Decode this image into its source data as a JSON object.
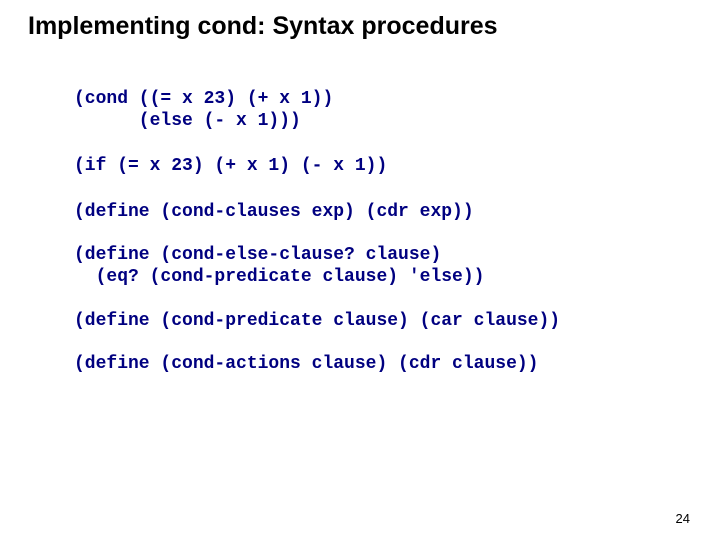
{
  "title": "Implementing cond: Syntax procedures",
  "code": {
    "line1": "(cond ((= x 23) (+ x 1))",
    "line2": "      (else (- x 1)))",
    "line3": "(if (= x 23) (+ x 1) (- x 1))",
    "line4": "(define (cond-clauses exp) (cdr exp))",
    "line5": "(define (cond-else-clause? clause)",
    "line6": "  (eq? (cond-predicate clause) 'else))",
    "line7": "(define (cond-predicate clause) (car clause))",
    "line8": "(define (cond-actions clause) (cdr clause))"
  },
  "page_number": "24"
}
